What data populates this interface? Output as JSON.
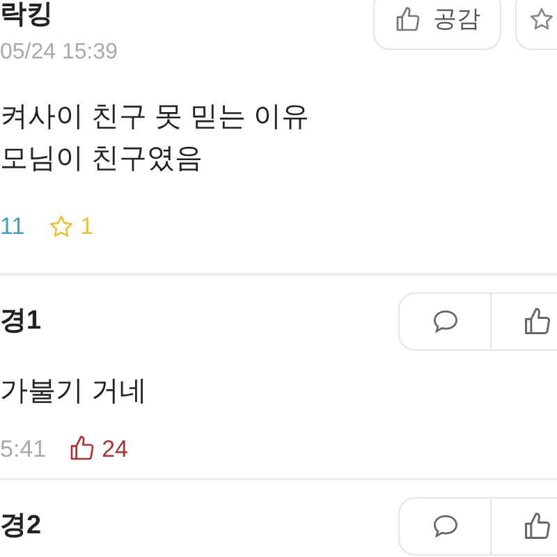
{
  "post": {
    "author": "락킹",
    "date": "05/24 15:39",
    "like_button": "공감",
    "body_lines": [
      "켜사이 친구 못 믿는 이유",
      "모님이 친구였음"
    ],
    "comment_count": "11",
    "star_count": "1"
  },
  "comments": [
    {
      "author": "경1",
      "text": "가불기 거네",
      "time": "5:41",
      "likes": "24"
    },
    {
      "author": "경2"
    }
  ]
}
